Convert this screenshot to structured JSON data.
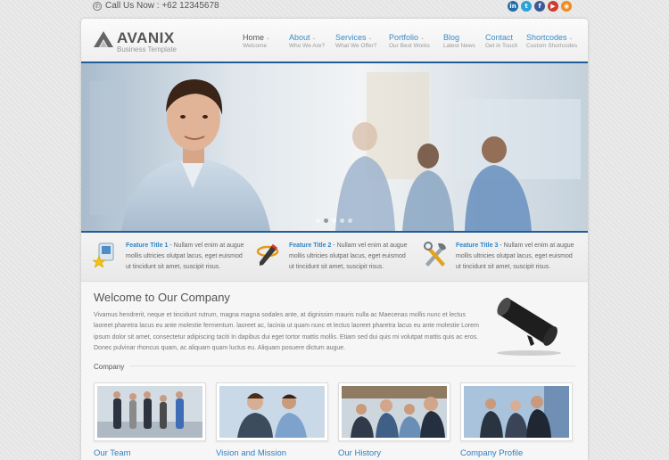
{
  "topbar": {
    "call_text": "Call Us Now : +62 12345678",
    "social": [
      {
        "icon": "linkedin-icon",
        "glyph": "in",
        "color": "#1f6fa8"
      },
      {
        "icon": "twitter-icon",
        "glyph": "t",
        "color": "#29a3d8"
      },
      {
        "icon": "facebook-icon",
        "glyph": "f",
        "color": "#3a5a98"
      },
      {
        "icon": "youtube-icon",
        "glyph": "▶",
        "color": "#d13a2d"
      },
      {
        "icon": "rss-icon",
        "glyph": "◉",
        "color": "#f28b1e"
      }
    ]
  },
  "header": {
    "logo_name": "AVANIX",
    "logo_tagline": "Business Template",
    "nav": [
      {
        "label": "Home",
        "sub": "Welcome",
        "dropdown": true,
        "active": true
      },
      {
        "label": "About",
        "sub": "Who We Are?",
        "dropdown": true,
        "active": false
      },
      {
        "label": "Services",
        "sub": "What We Offer?",
        "dropdown": true,
        "active": false
      },
      {
        "label": "Portfolio",
        "sub": "Our Best Works",
        "dropdown": true,
        "active": false
      },
      {
        "label": "Blog",
        "sub": "Latest News",
        "dropdown": false,
        "active": false
      },
      {
        "label": "Contact",
        "sub": "Get in Touch",
        "dropdown": false,
        "active": false
      },
      {
        "label": "Shortcodes",
        "sub": "Custom Shortcodes",
        "dropdown": true,
        "active": false
      }
    ]
  },
  "slider": {
    "slide_count": 5,
    "active_slide": 2
  },
  "features": [
    {
      "title": "Feature Title 1",
      "text": " - Nullam vel enim at augue mollis ultricies olutpat lacus, eget euismod ut tincidunt sit amet, suscipit risus.",
      "icon": "computer-star-icon"
    },
    {
      "title": "Feature Title 2",
      "text": " - Nullam vel enim at augue mollis ultricies olutpat lacus, eget euismod ut tincidunt sit amet, suscipit risus.",
      "icon": "pencil-ring-icon"
    },
    {
      "title": "Feature Title 3",
      "text": " - Nullam vel enim at augue mollis ultricies olutpat lacus, eget euismod ut tincidunt sit amet, suscipit risus.",
      "icon": "tools-icon"
    }
  ],
  "welcome": {
    "title": "Welcome to Our Company",
    "text": "Vivamus hendrerit, neque et tincidunt rutrum, magna magna sodales ante, at dignissim mauris nulla ac Maecenas mollis nunc et lectus laoreet pharetra lacus eu ante molestie fermentum. laoreet ac, lacinia ut quam nunc et lectus laoreet pharetra lacus eu ante molestie Lorem ipsum dolor sit amet, consectetur adipiscing taciti In dapibus dui eget tortor mattis mollis. Etiam sed dui quis mi volutpat mattis quis ac eros. Donec pulvinar rhoncus quam, ac aliquam quam luctus eu. Aliquam posuere dictum augue."
  },
  "section_label": "Company",
  "cards": [
    {
      "title": "Our Team"
    },
    {
      "title": "Vision and Mission"
    },
    {
      "title": "Our History"
    },
    {
      "title": "Company Profile"
    }
  ],
  "colors": {
    "link_blue": "#2f7fc2",
    "nav_blue": "#3a8bc4",
    "slider_border": "#1f5c99"
  }
}
